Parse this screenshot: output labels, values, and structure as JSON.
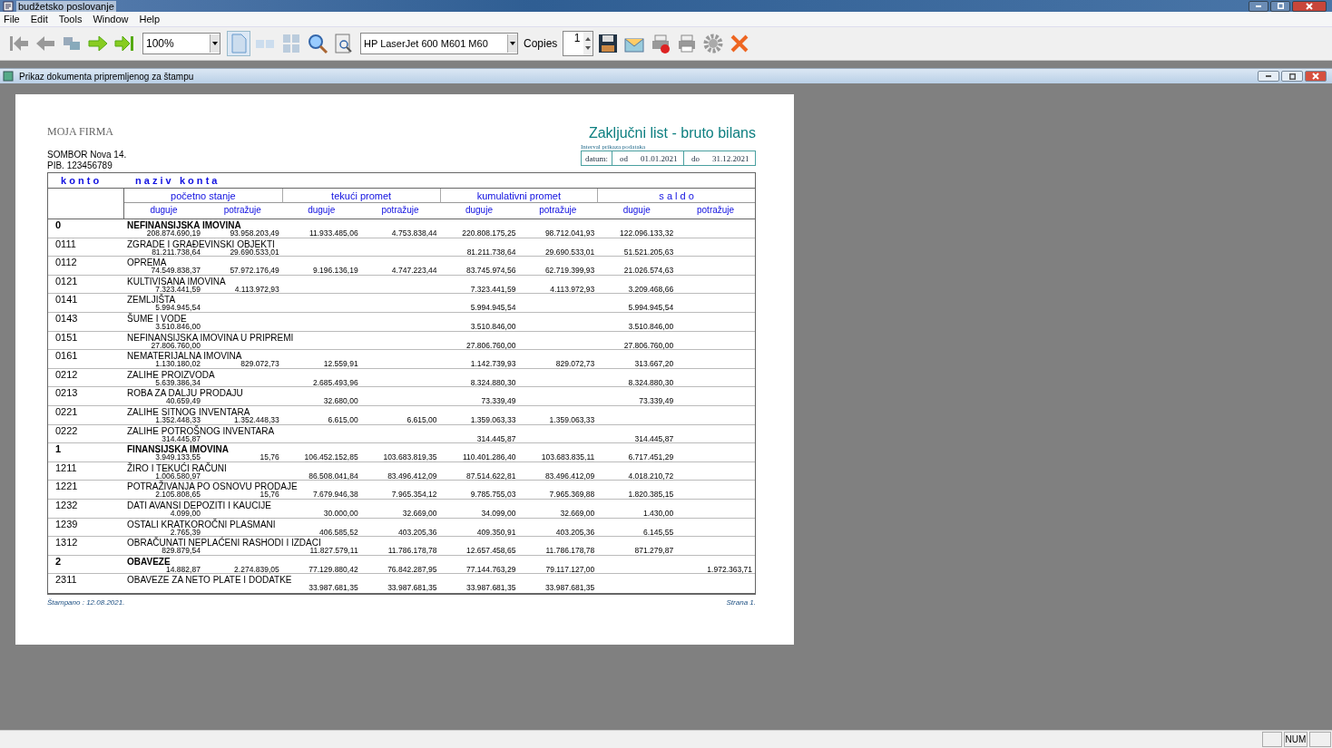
{
  "window": {
    "title": "budžetsko poslovanje"
  },
  "menu": [
    "File",
    "Edit",
    "Tools",
    "Window",
    "Help"
  ],
  "toolbar": {
    "zoom": "100%",
    "printer": "HP LaserJet 600 M601 M60",
    "copies_label": "Copies",
    "copies": "1"
  },
  "child_window": {
    "title": "Prikaz dokumenta pripremljenog za štampu"
  },
  "report": {
    "company": "MOJA FIRMA",
    "address": "SOMBOR Nova 14.",
    "pib": "PIB. 123456789",
    "title": "Zaključni list - bruto bilans",
    "interval_label": "Interval prikaza podataka",
    "date_label": "datum:",
    "from_label": "od",
    "from": "01.01.2021",
    "to_label": "do",
    "to": "31.12.2021",
    "head_konto": "k o n t o",
    "head_naziv": "n a z i v   k o n t a",
    "groups": [
      "početno stanje",
      "tekući promet",
      "kumulativni promet",
      "s a l d o"
    ],
    "subcolumns": [
      "duguje",
      "potražuje",
      "duguje",
      "potražuje",
      "duguje",
      "potražuje",
      "duguje",
      "potražuje"
    ],
    "rows": [
      {
        "kind": "group",
        "konto": "0",
        "naziv": "NEFINANSIJSKA IMOVINA",
        "opening_debit": "208.874.690,19",
        "opening_credit": "93.958.203,49",
        "turnover_debit": "11.933.485,06",
        "turnover_credit": "4.753.838,44",
        "cumulative_debit": "220.808.175,25",
        "cumulative_credit": "98.712.041,93",
        "balance_debit": "122.096.133,32"
      },
      {
        "kind": "account",
        "konto": "0111",
        "naziv": "ZGRADE I GRAĐEVINSKI OBJEKTI",
        "opening_debit": "81.211.738,64",
        "opening_credit": "29.690.533,01",
        "cumulative_debit": "81.211.738,64",
        "cumulative_credit": "29.690.533,01",
        "balance_debit": "51.521.205,63"
      },
      {
        "kind": "account",
        "konto": "0112",
        "naziv": "OPREMA",
        "opening_debit": "74.549.838,37",
        "opening_credit": "57.972.176,49",
        "turnover_debit": "9.196.136,19",
        "turnover_credit": "4.747.223,44",
        "cumulative_debit": "83.745.974,56",
        "cumulative_credit": "62.719.399,93",
        "balance_debit": "21.026.574,63"
      },
      {
        "kind": "account",
        "konto": "0121",
        "naziv": "KULTIVISANA IMOVINA",
        "opening_debit": "7.323.441,59",
        "opening_credit": "4.113.972,93",
        "cumulative_debit": "7.323.441,59",
        "cumulative_credit": "4.113.972,93",
        "balance_debit": "3.209.468,66"
      },
      {
        "kind": "account",
        "konto": "0141",
        "naziv": "ZEMLJIŠTA",
        "opening_debit": "5.994.945,54",
        "cumulative_debit": "5.994.945,54",
        "balance_debit": "5.994.945,54"
      },
      {
        "kind": "account",
        "konto": "0143",
        "naziv": "ŠUME I VODE",
        "opening_debit": "3.510.846,00",
        "cumulative_debit": "3.510.846,00",
        "balance_debit": "3.510.846,00"
      },
      {
        "kind": "account",
        "konto": "0151",
        "naziv": "NEFINANSIJSKA IMOVINA U PRIPREMI",
        "opening_debit": "27.806.760,00",
        "cumulative_debit": "27.806.760,00",
        "balance_debit": "27.806.760,00"
      },
      {
        "kind": "account",
        "konto": "0161",
        "naziv": "NEMATERIJALNA IMOVINA",
        "opening_debit": "1.130.180,02",
        "opening_credit": "829.072,73",
        "turnover_debit": "12.559,91",
        "cumulative_debit": "1.142.739,93",
        "cumulative_credit": "829.072,73",
        "balance_debit": "313.667,20"
      },
      {
        "kind": "account",
        "konto": "0212",
        "naziv": "ZALIHE PROIZVODA",
        "opening_debit": "5.639.386,34",
        "turnover_debit": "2.685.493,96",
        "cumulative_debit": "8.324.880,30",
        "balance_debit": "8.324.880,30"
      },
      {
        "kind": "account",
        "konto": "0213",
        "naziv": "ROBA ZA DALJU PRODAJU",
        "opening_debit": "40.659,49",
        "turnover_debit": "32.680,00",
        "cumulative_debit": "73.339,49",
        "balance_debit": "73.339,49"
      },
      {
        "kind": "account",
        "konto": "0221",
        "naziv": "ZALIHE SITNOG INVENTARA",
        "opening_debit": "1.352.448,33",
        "opening_credit": "1.352.448,33",
        "turnover_debit": "6.615,00",
        "turnover_credit": "6.615,00",
        "cumulative_debit": "1.359.063,33",
        "cumulative_credit": "1.359.063,33"
      },
      {
        "kind": "account",
        "konto": "0222",
        "naziv": "ZALIHE POTROŠNOG INVENTARA",
        "opening_debit": "314.445,87",
        "cumulative_debit": "314.445,87",
        "balance_debit": "314.445,87"
      },
      {
        "kind": "group",
        "konto": "1",
        "naziv": "FINANSIJSKA IMOVINA",
        "opening_debit": "3.949.133,55",
        "opening_credit": "15,76",
        "turnover_debit": "106.452.152,85",
        "turnover_credit": "103.683.819,35",
        "cumulative_debit": "110.401.286,40",
        "cumulative_credit": "103.683.835,11",
        "balance_debit": "6.717.451,29"
      },
      {
        "kind": "account",
        "konto": "1211",
        "naziv": "ŽIRO I TEKUĆI RAČUNI",
        "opening_debit": "1.006.580,97",
        "turnover_debit": "86.508.041,84",
        "turnover_credit": "83.496.412,09",
        "cumulative_debit": "87.514.622,81",
        "cumulative_credit": "83.496.412,09",
        "balance_debit": "4.018.210,72"
      },
      {
        "kind": "account",
        "konto": "1221",
        "naziv": "POTRAŽIVANJA PO OSNOVU PRODAJE",
        "opening_debit": "2.105.808,65",
        "opening_credit": "15,76",
        "turnover_debit": "7.679.946,38",
        "turnover_credit": "7.965.354,12",
        "cumulative_debit": "9.785.755,03",
        "cumulative_credit": "7.965.369,88",
        "balance_debit": "1.820.385,15"
      },
      {
        "kind": "account",
        "konto": "1232",
        "naziv": "DATI AVANSI DEPOZITI I KAUCIJE",
        "opening_debit": "4.099,00",
        "turnover_debit": "30.000,00",
        "turnover_credit": "32.669,00",
        "cumulative_debit": "34.099,00",
        "cumulative_credit": "32.669,00",
        "balance_debit": "1.430,00"
      },
      {
        "kind": "account",
        "konto": "1239",
        "naziv": "OSTALI KRATKOROČNI PLASMANI",
        "opening_debit": "2.765,39",
        "turnover_debit": "406.585,52",
        "turnover_credit": "403.205,36",
        "cumulative_debit": "409.350,91",
        "cumulative_credit": "403.205,36",
        "balance_debit": "6.145,55"
      },
      {
        "kind": "account",
        "konto": "1312",
        "naziv": "OBRAČUNATI NEPLAĆENI RASHODI I IZDACI",
        "opening_debit": "829.879,54",
        "turnover_debit": "11.827.579,11",
        "turnover_credit": "11.786.178,78",
        "cumulative_debit": "12.657.458,65",
        "cumulative_credit": "11.786.178,78",
        "balance_debit": "871.279,87"
      },
      {
        "kind": "group",
        "konto": "2",
        "naziv": "OBAVEZE",
        "opening_debit": "14.882,87",
        "opening_credit": "2.274.839,05",
        "turnover_debit": "77.129.880,42",
        "turnover_credit": "76.842.287,95",
        "cumulative_debit": "77.144.763,29",
        "cumulative_credit": "79.117.127,00",
        "balance_credit": "1.972.363,71"
      },
      {
        "kind": "account",
        "konto": "2311",
        "naziv": "OBAVEZE ZA NETO PLATE I DODATKE",
        "turnover_debit": "33.987.681,35",
        "turnover_credit": "33.987.681,35",
        "cumulative_debit": "33.987.681,35",
        "cumulative_credit": "33.987.681,35"
      }
    ],
    "printed": "Štampano : 12.08.2021.",
    "page": "Strana  1."
  },
  "status_bar": {
    "indicator": "NUM"
  }
}
